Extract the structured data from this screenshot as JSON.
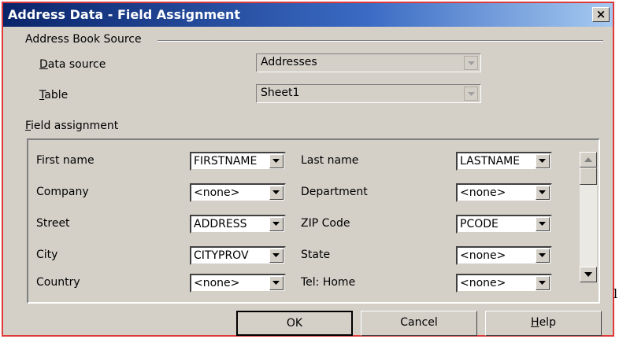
{
  "window": {
    "title": "Address Data - Field Assignment",
    "close_label": "×"
  },
  "source_group": {
    "title": "Address Book Source",
    "data_source": {
      "label_u": "D",
      "label_rest": "ata source",
      "value": "Addresses"
    },
    "table": {
      "label_u": "T",
      "label_rest": "able",
      "value": "Sheet1"
    }
  },
  "field_group": {
    "title_u": "F",
    "title_rest": "ield assignment",
    "rows": [
      {
        "left_label": "First name",
        "left_value": "FIRSTNAME",
        "right_label": "Last name",
        "right_value": "LASTNAME"
      },
      {
        "left_label": "Company",
        "left_value": "<none>",
        "right_label": "Department",
        "right_value": "<none>"
      },
      {
        "left_label": "Street",
        "left_value": "ADDRESS",
        "right_label": "ZIP Code",
        "right_value": "PCODE"
      },
      {
        "left_label": "City",
        "left_value": "CITYPROV",
        "right_label": "State",
        "right_value": "<none>"
      },
      {
        "left_label": "Country",
        "left_value": "<none>",
        "right_label": "Tel: Home",
        "right_value": "<none>"
      }
    ]
  },
  "buttons": {
    "ok": "OK",
    "cancel": "Cancel",
    "help_u": "H",
    "help_rest": "elp"
  },
  "stray_char": "l"
}
